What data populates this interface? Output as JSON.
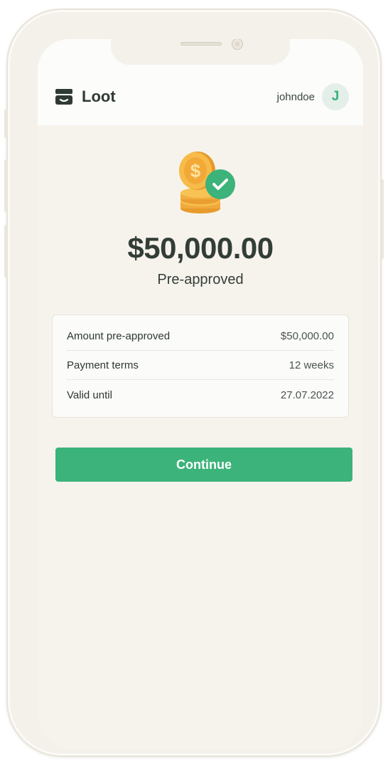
{
  "app": {
    "name": "Loot",
    "username": "johndoe",
    "avatar_initial": "J"
  },
  "icons": {
    "brand": "store-icon",
    "hero": "coins-check-icon"
  },
  "offer": {
    "amount": "$50,000.00",
    "status": "Pre-approved"
  },
  "details": [
    {
      "label": "Amount pre-approved",
      "value": "$50,000.00"
    },
    {
      "label": "Payment terms",
      "value": "12 weeks"
    },
    {
      "label": "Valid until",
      "value": "27.07.2022"
    }
  ],
  "actions": {
    "continue_label": "Continue"
  },
  "colors": {
    "accent": "#3bb37a",
    "text": "#333d38",
    "background": "#f6f3ec",
    "coin": "#f5b544"
  }
}
